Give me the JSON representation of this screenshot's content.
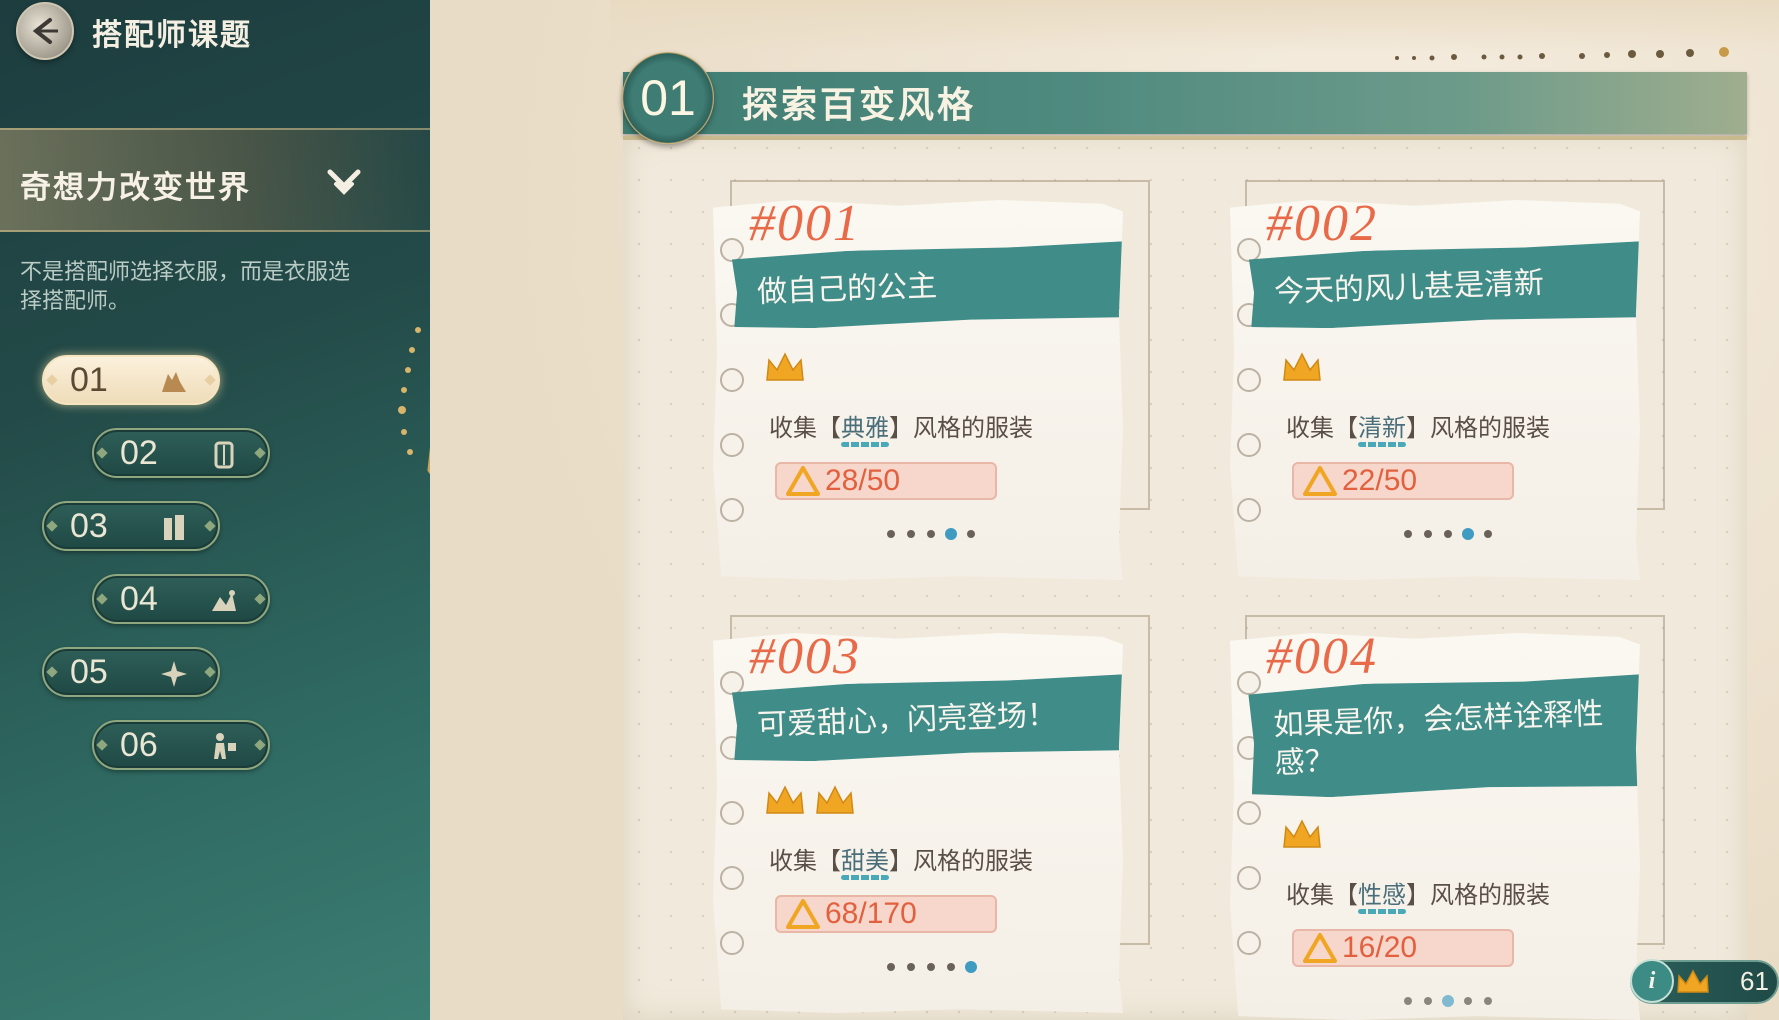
{
  "header": {
    "title": "搭配师课题"
  },
  "chapter": {
    "title": "奇想力改变世界",
    "description": "不是搭配师选择衣服，而是衣服选择搭配师。"
  },
  "levels": [
    {
      "label": "01",
      "icon": "outfit-icon",
      "active": true
    },
    {
      "label": "02",
      "icon": "wardrobe-icon",
      "active": false
    },
    {
      "label": "03",
      "icon": "book-icon",
      "active": false
    },
    {
      "label": "04",
      "icon": "mirror-icon",
      "active": false
    },
    {
      "label": "05",
      "icon": "sparkle-icon",
      "active": false
    },
    {
      "label": "06",
      "icon": "figure-icon",
      "active": false
    }
  ],
  "section": {
    "number": "01",
    "title": "探索百变风格"
  },
  "cards": [
    {
      "tag": "#001",
      "title": "做自己的公主",
      "crowns": 1,
      "task_prefix": "收集【",
      "keyword": "典雅",
      "task_suffix": "】风格的服装",
      "progress": "28/50",
      "dots_total": 5,
      "dots_active": 4
    },
    {
      "tag": "#002",
      "title": "今天的风儿甚是清新",
      "crowns": 1,
      "task_prefix": "收集【",
      "keyword": "清新",
      "task_suffix": "】风格的服装",
      "progress": "22/50",
      "dots_total": 5,
      "dots_active": 4
    },
    {
      "tag": "#003",
      "title": "可爱甜心，闪亮登场！",
      "crowns": 2,
      "task_prefix": "收集【",
      "keyword": "甜美",
      "task_suffix": "】风格的服装",
      "progress": "68/170",
      "dots_total": 5,
      "dots_active": 5
    },
    {
      "tag": "#004",
      "title": "如果是你，会怎样诠释性感？",
      "crowns": 1,
      "task_prefix": "收集【",
      "keyword": "性感",
      "task_suffix": "】风格的服装",
      "progress": "16/20",
      "dots_total": 5,
      "dots_active": 3
    }
  ],
  "counter": {
    "info_glyph": "i",
    "value": "61"
  },
  "colors": {
    "teal_banner": "#3f8c88",
    "progress_text": "#e3603f",
    "tag_text": "#e86a49",
    "crown_gold": "#f0a623",
    "panel_teal": "#234a48"
  }
}
